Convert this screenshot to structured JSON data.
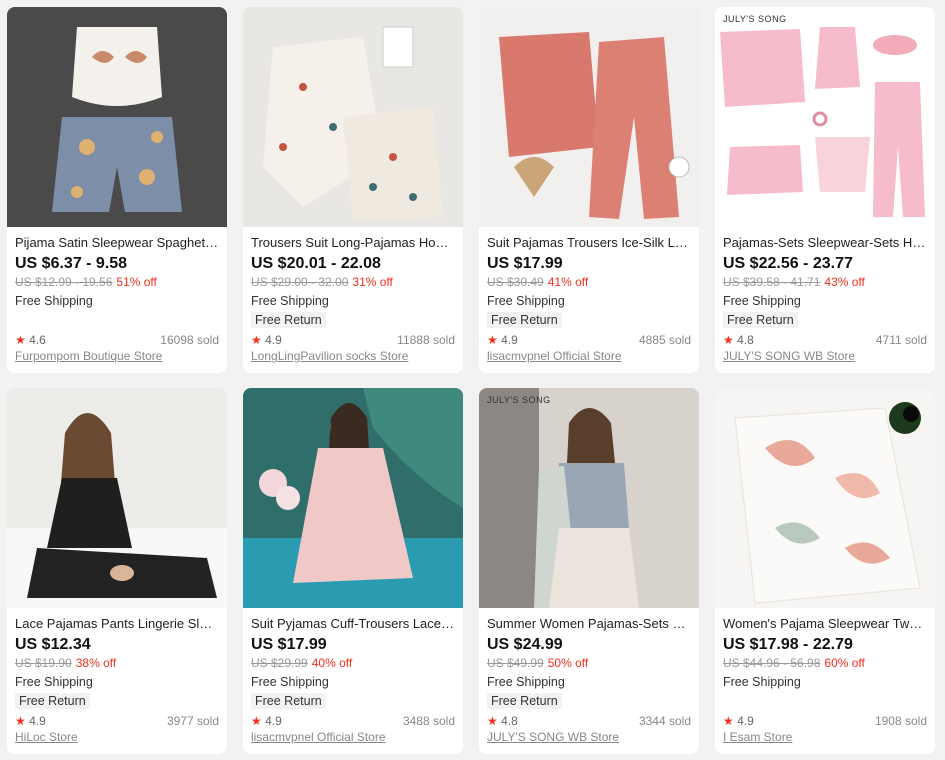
{
  "products": [
    {
      "title": "Pijama Satin Sleepwear Spaghetti-...",
      "price": "US $6.37 - 9.58",
      "original": "US $12.99 - 19.56",
      "discount": "51% off",
      "shipping": "Free Shipping",
      "free_return": "",
      "rating": "4.6",
      "sold": "16098 sold",
      "store": "Furpompom Boutique Store"
    },
    {
      "title": "Trousers Suit Long-Pajamas Home...",
      "price": "US $20.01 - 22.08",
      "original": "US $29.00 - 32.00",
      "discount": "31% off",
      "shipping": "Free Shipping",
      "free_return": "Free Return",
      "rating": "4.9",
      "sold": "11888 sold",
      "store": "LongLingPavilion socks Store"
    },
    {
      "title": "Suit Pajamas Trousers Ice-Silk Lon...",
      "price": "US $17.99",
      "original": "US $30.49",
      "discount": "41% off",
      "shipping": "Free Shipping",
      "free_return": "Free Return",
      "rating": "4.9",
      "sold": "4885 sold",
      "store": "lisacmvpnel Official Store"
    },
    {
      "title": "Pajamas-Sets Sleepwear-Sets Hom...",
      "price": "US $22.56 - 23.77",
      "original": "US $39.58 - 41.71",
      "discount": "43% off",
      "shipping": "Free Shipping",
      "free_return": "Free Return",
      "rating": "4.8",
      "sold": "4711 sold",
      "store": "JULY'S SONG WB Store",
      "image_text": "JULY'S SONG"
    },
    {
      "title": "Lace Pajamas Pants Lingerie Sleep...",
      "price": "US $12.34",
      "original": "US $19.90",
      "discount": "38% off",
      "shipping": "Free Shipping",
      "free_return": "Free Return",
      "rating": "4.9",
      "sold": "3977 sold",
      "store": "HiLoc Store"
    },
    {
      "title": "Suit Pyjamas Cuff-Trousers Lace L...",
      "price": "US $17.99",
      "original": "US $29.99",
      "discount": "40% off",
      "shipping": "Free Shipping",
      "free_return": "Free Return",
      "rating": "4.9",
      "sold": "3488 sold",
      "store": "lisacmvpnel Official Store"
    },
    {
      "title": "Summer Women Pajamas-Sets Sle...",
      "price": "US $24.99",
      "original": "US $49.99",
      "discount": "50% off",
      "shipping": "Free Shipping",
      "free_return": "Free Return",
      "rating": "4.8",
      "sold": "3344 sold",
      "store": "JULY'S SONG WB Store",
      "image_text": "JULY'S SONG"
    },
    {
      "title": "Women's Pajama Sleepwear Two-...",
      "price": "US $17.98 - 22.79",
      "original": "US $44.96 - 56.98",
      "discount": "60% off",
      "shipping": "Free Shipping",
      "free_return": "",
      "rating": "4.9",
      "sold": "1908 sold",
      "store": "I Esam Store"
    }
  ],
  "icons": {
    "rating_star": "star-icon"
  },
  "colors": {
    "discount": "#f2301f",
    "star": "#f2301f",
    "background": "#f2f2f2"
  }
}
